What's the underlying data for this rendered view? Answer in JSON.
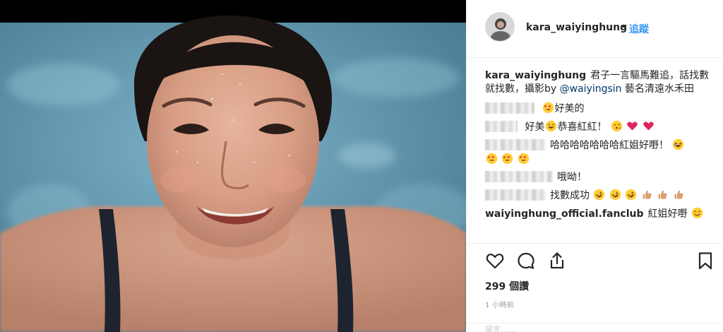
{
  "post": {
    "username": "kara_waiyinghung",
    "dot": "•",
    "follow_label": "追蹤"
  },
  "caption": {
    "username": "kara_waiyinghung",
    "text_before": "君子一言驅馬難追，話找數就找數，攝影by",
    "mention": "@waiyingsin",
    "text_after": "藝名清遠水禾田"
  },
  "comments": [
    {
      "text": "好美的",
      "emojis_after": [
        "heart-eyes"
      ]
    },
    {
      "text": "好美",
      "mid_emoji": "grin",
      "text2": "恭喜紅紅！",
      "emojis_after": [
        "kiss",
        "red-heart",
        "red-heart"
      ]
    },
    {
      "text": "哈哈哈哈哈哈哈紅姐好嘢！",
      "emojis_after": [
        "laughing"
      ],
      "emojis_line2": [
        "heart-eyes",
        "heart-eyes",
        "heart-eyes"
      ]
    },
    {
      "text": "哦呦！",
      "emojis_after": []
    },
    {
      "text": "找數成功",
      "emojis_after": [
        "rofl",
        "rofl",
        "rofl",
        "thumbs-up",
        "thumbs-up",
        "thumbs-up"
      ]
    },
    {
      "username": "waiyinghung_official.fanclub",
      "text": "紅姐好嘢",
      "emojis_after": [
        "smile"
      ]
    }
  ],
  "actions": {
    "like_icon": "heart-outline-icon",
    "comment_icon": "comment-bubble-icon",
    "share_icon": "share-icon",
    "save_icon": "bookmark-icon"
  },
  "likes_text": "299 個讚",
  "timestamp": "1 小時前",
  "add_comment_text": "留言……",
  "colors": {
    "link_blue": "#3897f0",
    "mention_blue": "#003569",
    "text": "#262626",
    "muted": "#999999",
    "water": "#5e8fa6"
  }
}
